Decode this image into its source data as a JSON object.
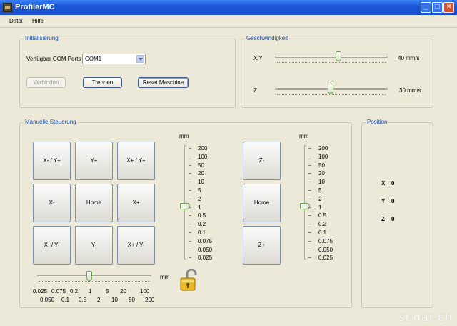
{
  "window": {
    "title": "ProfilerMC"
  },
  "menu": {
    "items": [
      "Datei",
      "Hilfe"
    ]
  },
  "init": {
    "legend": "Initialisierung",
    "com_label": "Verfügbar COM Ports",
    "com_value": "COM1",
    "connect_label": "Verbinden",
    "disconnect_label": "Trennen",
    "reset_label": "Reset Maschine"
  },
  "speed": {
    "legend": "Geschwindigkeit",
    "xy": {
      "label": "X/Y",
      "value_text": "40 mm/s",
      "level": 0.6
    },
    "z": {
      "label": "Z",
      "value_text": "30 mm/s",
      "level": 0.5
    }
  },
  "manual": {
    "legend": "Manuelle Steuerung",
    "xy_buttons": [
      "X- / Y+",
      "Y+",
      "X+ / Y+",
      "X-",
      "Home",
      "X+",
      "X- / Y-",
      "Y-",
      "X+ / Y-"
    ],
    "z_buttons": [
      "Z-",
      "Home",
      "Z+"
    ],
    "unit": "mm",
    "step_values": [
      "200",
      "100",
      "50",
      "20",
      "10",
      "5",
      "2",
      "1",
      "0.5",
      "0.2",
      "0.1",
      "0.075",
      "0.050",
      "0.025"
    ],
    "xy_step_selected": "1",
    "z_step_selected": "1",
    "h_scale_top": [
      "0.025",
      "0.075",
      "0.2",
      "1",
      "5",
      "20",
      "100"
    ],
    "h_scale_bottom": [
      "0.050",
      "0.1",
      "0.5",
      "2",
      "10",
      "50",
      "200"
    ],
    "h_unit": "mm",
    "h_selected": "1"
  },
  "position": {
    "legend": "Position",
    "x_label": "X",
    "x_value": "0",
    "y_label": "Y",
    "y_value": "0",
    "z_label": "Z",
    "z_value": "0"
  },
  "watermark": "sudar.ch",
  "colors": {
    "titlebar": "#1b56d9",
    "legend": "#1f4fa8",
    "background": "#ece9d8",
    "lock": "#e8b923"
  }
}
